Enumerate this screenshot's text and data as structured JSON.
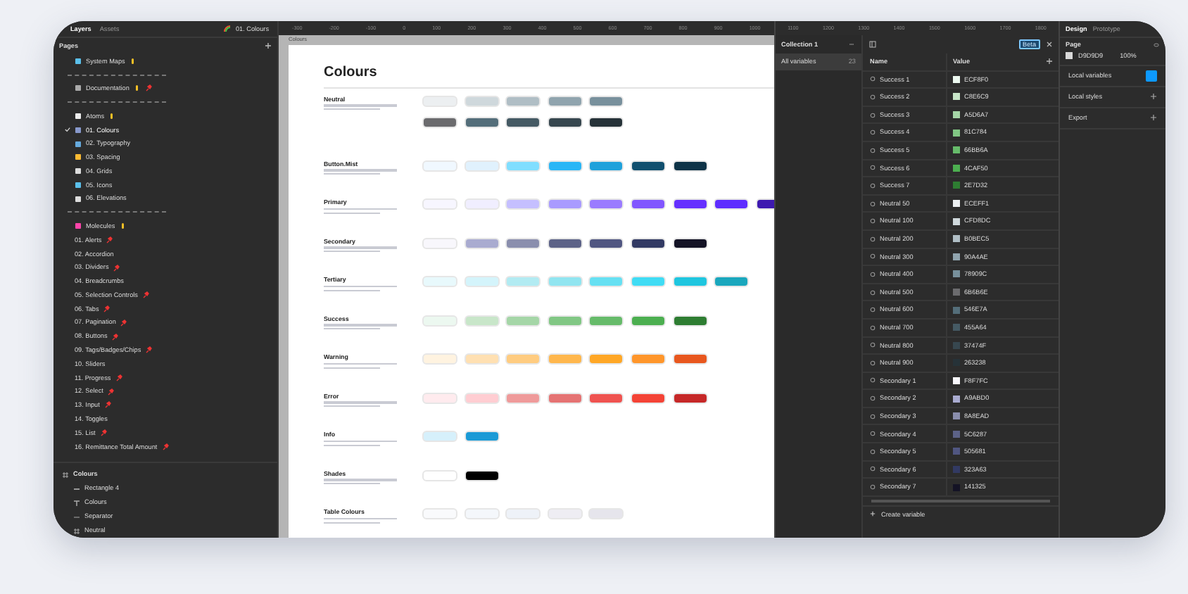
{
  "sidebar": {
    "tabs": [
      {
        "label": "Layers",
        "selected": true
      },
      {
        "label": "Assets",
        "selected": false
      }
    ],
    "current_page": "01. Colours",
    "pages_header": "Pages",
    "pages": [
      {
        "kind": "section",
        "label": "System Maps",
        "selected": false,
        "pinned": false
      },
      {
        "kind": "separator"
      },
      {
        "kind": "section",
        "label": "Documentation",
        "selected": false,
        "pinned": true
      },
      {
        "kind": "separator"
      },
      {
        "kind": "section",
        "label": "Atoms",
        "selected": false,
        "pinned": false
      },
      {
        "kind": "page",
        "label": "01. Colours",
        "selected": true,
        "pinned": false
      },
      {
        "kind": "page",
        "label": "02. Typography",
        "selected": false,
        "pinned": false
      },
      {
        "kind": "page",
        "label": "03. Spacing",
        "selected": false,
        "pinned": false
      },
      {
        "kind": "page",
        "label": "04. Grids",
        "selected": false,
        "pinned": false
      },
      {
        "kind": "page",
        "label": "05. Icons",
        "selected": false,
        "pinned": false
      },
      {
        "kind": "page",
        "label": "06. Elevations",
        "selected": false,
        "pinned": false
      },
      {
        "kind": "separator"
      },
      {
        "kind": "section",
        "label": "Molecules",
        "selected": false,
        "pinned": false
      },
      {
        "kind": "plain",
        "label": "01. Alerts",
        "selected": false,
        "pinned": true
      },
      {
        "kind": "plain",
        "label": "02. Accordion",
        "selected": false,
        "pinned": false
      },
      {
        "kind": "plain",
        "label": "03. Dividers",
        "selected": false,
        "pinned": true
      },
      {
        "kind": "plain",
        "label": "04. Breadcrumbs",
        "selected": false,
        "pinned": false
      },
      {
        "kind": "plain",
        "label": "05. Selection Controls",
        "selected": false,
        "pinned": true
      },
      {
        "kind": "plain",
        "label": "06. Tabs",
        "selected": false,
        "pinned": true
      },
      {
        "kind": "plain",
        "label": "07. Pagination",
        "selected": false,
        "pinned": true
      },
      {
        "kind": "plain",
        "label": "08. Buttons",
        "selected": false,
        "pinned": true
      },
      {
        "kind": "plain",
        "label": "09. Tags/Badges/Chips",
        "selected": false,
        "pinned": true
      },
      {
        "kind": "plain",
        "label": "10. Sliders",
        "selected": false,
        "pinned": false
      },
      {
        "kind": "plain",
        "label": "11. Progress",
        "selected": false,
        "pinned": true
      },
      {
        "kind": "plain",
        "label": "12. Select",
        "selected": false,
        "pinned": true
      },
      {
        "kind": "plain",
        "label": "13. Input",
        "selected": false,
        "pinned": true
      },
      {
        "kind": "plain",
        "label": "14. Toggles",
        "selected": false,
        "pinned": false
      },
      {
        "kind": "plain",
        "label": "15. List",
        "selected": false,
        "pinned": true
      },
      {
        "kind": "plain",
        "label": "16. Remittance Total Amount",
        "selected": false,
        "pinned": true
      }
    ],
    "layers": [
      {
        "kind": "frame",
        "label": "Colours",
        "children": [
          {
            "kind": "rect",
            "label": "Rectangle 4"
          },
          {
            "kind": "text",
            "label": "Colours"
          },
          {
            "kind": "line",
            "label": "Separator"
          },
          {
            "kind": "frame",
            "label": "Neutral"
          }
        ]
      }
    ]
  },
  "canvas": {
    "ruler": [
      "-300",
      "-200",
      "-100",
      "0",
      "100",
      "200",
      "300",
      "400",
      "500",
      "600",
      "700",
      "800",
      "900",
      "1000"
    ],
    "frame_label": "Colours",
    "title": "Colours",
    "sections": [
      {
        "name": "Neutral",
        "rows": [
          [
            {
              "color": "#eceff1"
            },
            {
              "color": "#cfd8dc"
            },
            {
              "color": "#b0bec5"
            },
            {
              "color": "#90a4ae"
            },
            {
              "color": "#78909c"
            }
          ],
          [
            {
              "color": "#6b6b6e"
            },
            {
              "color": "#546e7a"
            },
            {
              "color": "#455a64"
            },
            {
              "color": "#37474f"
            },
            {
              "color": "#263238"
            }
          ]
        ]
      },
      {
        "name": "Button.Mist",
        "rows": [
          [
            {
              "color": "#f0f8ff"
            },
            {
              "color": "#e0f1fd"
            },
            {
              "color": "#80deff"
            },
            {
              "color": "#29b6f6"
            },
            {
              "color": "#1fa1db"
            },
            {
              "color": "#114f6e"
            },
            {
              "color": "#0e3347"
            }
          ]
        ]
      },
      {
        "name": "Primary",
        "rows": [
          [
            {
              "color": "#f7f6ff"
            },
            {
              "color": "#f0eeff"
            },
            {
              "color": "#c5bfff"
            },
            {
              "color": "#a99bff"
            },
            {
              "color": "#9a7bff"
            },
            {
              "color": "#8156ff"
            },
            {
              "color": "#6530ff"
            },
            {
              "color": "#5e2dff"
            },
            {
              "color": "#3e1ab0"
            }
          ]
        ]
      },
      {
        "name": "Secondary",
        "rows": [
          [
            {
              "color": "#f8f7fc"
            },
            {
              "color": "#a9abd0"
            },
            {
              "color": "#8a8ead"
            },
            {
              "color": "#5c6287"
            },
            {
              "color": "#505681"
            },
            {
              "color": "#323a63"
            },
            {
              "color": "#141325"
            }
          ]
        ]
      },
      {
        "name": "Tertiary",
        "rows": [
          [
            {
              "color": "#e8f9fc"
            },
            {
              "color": "#d4f4fb"
            },
            {
              "color": "#b2ebf2"
            },
            {
              "color": "#91e5f0"
            },
            {
              "color": "#66e0f2"
            },
            {
              "color": "#40dcf4"
            },
            {
              "color": "#1fc6df"
            },
            {
              "color": "#1aa7bd"
            }
          ]
        ]
      },
      {
        "name": "Success",
        "rows": [
          [
            {
              "color": "#ecf8f0"
            },
            {
              "color": "#c8e6c9"
            },
            {
              "color": "#a5d6a7"
            },
            {
              "color": "#81c784"
            },
            {
              "color": "#66bb6a"
            },
            {
              "color": "#4caf50"
            },
            {
              "color": "#2e7d32"
            }
          ]
        ]
      },
      {
        "name": "Warning",
        "rows": [
          [
            {
              "color": "#fff3e0"
            },
            {
              "color": "#ffe0b2"
            },
            {
              "color": "#ffcc80"
            },
            {
              "color": "#ffb74d"
            },
            {
              "color": "#ffa726"
            },
            {
              "color": "#ff962b"
            },
            {
              "color": "#e8571e"
            }
          ]
        ]
      },
      {
        "name": "Error",
        "rows": [
          [
            {
              "color": "#ffebee"
            },
            {
              "color": "#ffcdd2"
            },
            {
              "color": "#ef9a9a"
            },
            {
              "color": "#e57373"
            },
            {
              "color": "#ef5350"
            },
            {
              "color": "#f44336"
            },
            {
              "color": "#c62828"
            }
          ]
        ]
      },
      {
        "name": "Info",
        "rows": [
          [
            {
              "color": "#d6f0fb"
            },
            {
              "color": "#1b9ad6"
            }
          ]
        ]
      },
      {
        "name": "Shades",
        "rows": [
          [
            {
              "color": "#ffffff"
            },
            {
              "color": "#000000"
            }
          ]
        ]
      },
      {
        "name": "Table Colours",
        "rows": [
          [
            {
              "color": "#f9fafc"
            },
            {
              "color": "#f4f7fb"
            },
            {
              "color": "#eef2f8"
            },
            {
              "color": "#eeedf3"
            },
            {
              "color": "#e6e5ec"
            }
          ]
        ]
      }
    ]
  },
  "variables": {
    "ruler": [
      "1100",
      "1200",
      "1300",
      "1400",
      "1500",
      "1600",
      "1700",
      "1800"
    ],
    "collection": "Collection 1",
    "groups": [
      {
        "label": "All variables",
        "count": "23",
        "selected": true
      }
    ],
    "badge": "Beta",
    "columns": [
      "Name",
      "Value"
    ],
    "rows": [
      {
        "name": "Success 1",
        "value": "ECF8F0",
        "color": "#ecf8f0"
      },
      {
        "name": "Success 2",
        "value": "C8E6C9",
        "color": "#c8e6c9"
      },
      {
        "name": "Success 3",
        "value": "A5D6A7",
        "color": "#a5d6a7"
      },
      {
        "name": "Success 4",
        "value": "81C784",
        "color": "#81c784"
      },
      {
        "name": "Success 5",
        "value": "66BB6A",
        "color": "#66bb6a"
      },
      {
        "name": "Success 6",
        "value": "4CAF50",
        "color": "#4caf50"
      },
      {
        "name": "Success 7",
        "value": "2E7D32",
        "color": "#2e7d32"
      },
      {
        "name": "Neutral 50",
        "value": "ECEFF1",
        "color": "#eceff1"
      },
      {
        "name": "Neutral 100",
        "value": "CFD8DC",
        "color": "#cfd8dc"
      },
      {
        "name": "Neutral 200",
        "value": "B0BEC5",
        "color": "#b0bec5"
      },
      {
        "name": "Neutral 300",
        "value": "90A4AE",
        "color": "#90a4ae"
      },
      {
        "name": "Neutral 400",
        "value": "78909C",
        "color": "#78909c"
      },
      {
        "name": "Neutral 500",
        "value": "6B6B6E",
        "color": "#6b6b6e"
      },
      {
        "name": "Neutral 600",
        "value": "546E7A",
        "color": "#546e7a"
      },
      {
        "name": "Neutral 700",
        "value": "455A64",
        "color": "#455a64"
      },
      {
        "name": "Neutral 800",
        "value": "37474F",
        "color": "#37474f"
      },
      {
        "name": "Neutral 900",
        "value": "263238",
        "color": "#263238"
      },
      {
        "name": "Secondary 1",
        "value": "F8F7FC",
        "color": "#f8f7fc"
      },
      {
        "name": "Secondary 2",
        "value": "A9ABD0",
        "color": "#a9abd0"
      },
      {
        "name": "Secondary 3",
        "value": "8A8EAD",
        "color": "#8a8ead"
      },
      {
        "name": "Secondary 4",
        "value": "5C6287",
        "color": "#5c6287"
      },
      {
        "name": "Secondary 5",
        "value": "505681",
        "color": "#505681"
      },
      {
        "name": "Secondary 6",
        "value": "323A63",
        "color": "#323a63"
      },
      {
        "name": "Secondary 7",
        "value": "141325",
        "color": "#141325"
      }
    ],
    "create": "Create variable"
  },
  "properties": {
    "tabs": [
      {
        "label": "Design",
        "selected": true
      },
      {
        "label": "Prototype",
        "selected": false
      }
    ],
    "page_label": "Page",
    "page_color": {
      "color": "#d9d9d9",
      "hex": "D9D9D9",
      "opacity": "100%"
    },
    "sections": [
      {
        "kind": "button",
        "label": "Local variables"
      },
      {
        "kind": "add",
        "label": "Local styles"
      },
      {
        "kind": "add",
        "label": "Export"
      }
    ]
  }
}
